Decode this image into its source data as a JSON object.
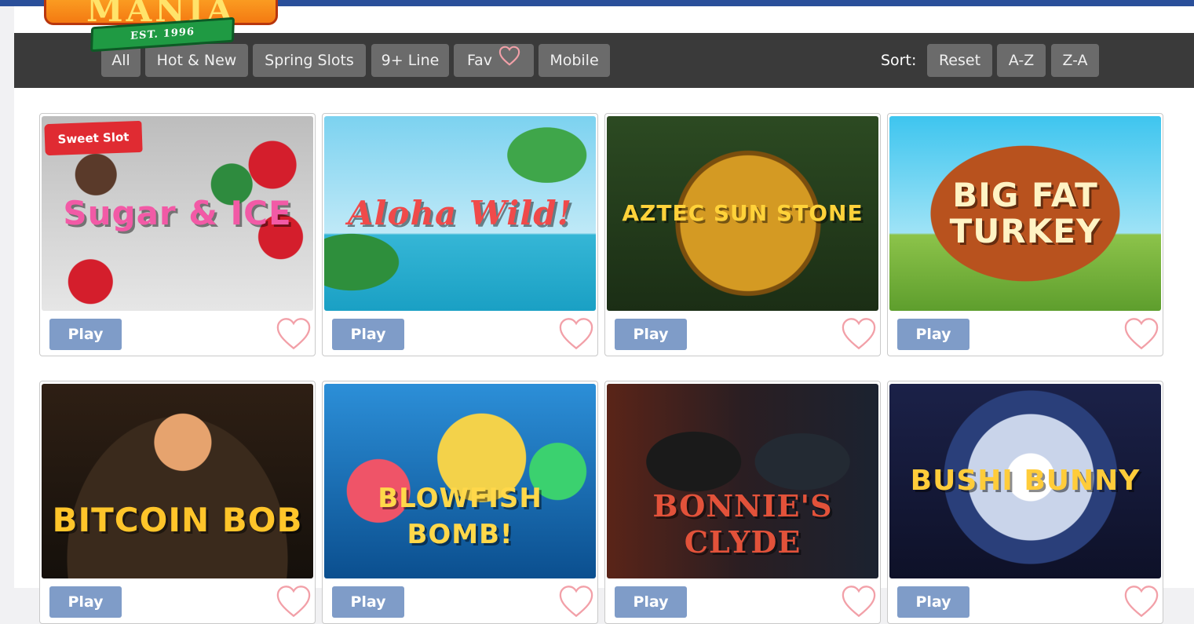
{
  "logo": {
    "word": "MANIA",
    "ribbon": "EST. 1996"
  },
  "nav": {
    "filters": [
      {
        "label": "All"
      },
      {
        "label": "Hot & New"
      },
      {
        "label": "Spring Slots"
      },
      {
        "label": "9+ Line"
      },
      {
        "label": "Fav",
        "icon": "heart-outline-icon"
      },
      {
        "label": "Mobile"
      }
    ],
    "sort_label": "Sort:",
    "sort_buttons": [
      {
        "label": "Reset"
      },
      {
        "label": "A-Z"
      },
      {
        "label": "Z-A"
      }
    ]
  },
  "colors": {
    "top_strip": "#2a4f9a",
    "nav_bg": "#3a3a3a",
    "pill_bg": "#6b6b6b",
    "play_button": "#7f9cc8",
    "heart": "#f2a0a8",
    "badge": "#e02b32"
  },
  "games": [
    {
      "title": "Sugar & ICE",
      "badge": "Sweet Slot",
      "play_label": "Play",
      "fav_icon": "heart-outline-icon",
      "title_color": "#f25aa6"
    },
    {
      "title": "Aloha Wild!",
      "play_label": "Play",
      "fav_icon": "heart-outline-icon",
      "title_color": "#f04a4a"
    },
    {
      "title": "AZTEC SUN STONE",
      "play_label": "Play",
      "fav_icon": "heart-outline-icon",
      "title_color": "#ffd23a"
    },
    {
      "title": "BIG FAT TURKEY",
      "play_label": "Play",
      "fav_icon": "heart-outline-icon",
      "title_color": "#fff3c4"
    },
    {
      "title": "BITCOIN BOB",
      "play_label": "Play",
      "fav_icon": "heart-outline-icon",
      "title_color": "#ffc52a"
    },
    {
      "title": "BLOWFISH BOMB!",
      "play_label": "Play",
      "fav_icon": "heart-outline-icon",
      "title_color": "#ffd84a"
    },
    {
      "title": "BONNIE'S CLYDE",
      "play_label": "Play",
      "fav_icon": "heart-outline-icon",
      "title_color": "#e2523a"
    },
    {
      "title": "BUSHI BUNNY",
      "play_label": "Play",
      "fav_icon": "heart-outline-icon",
      "title_color": "#ffcc3a"
    }
  ]
}
